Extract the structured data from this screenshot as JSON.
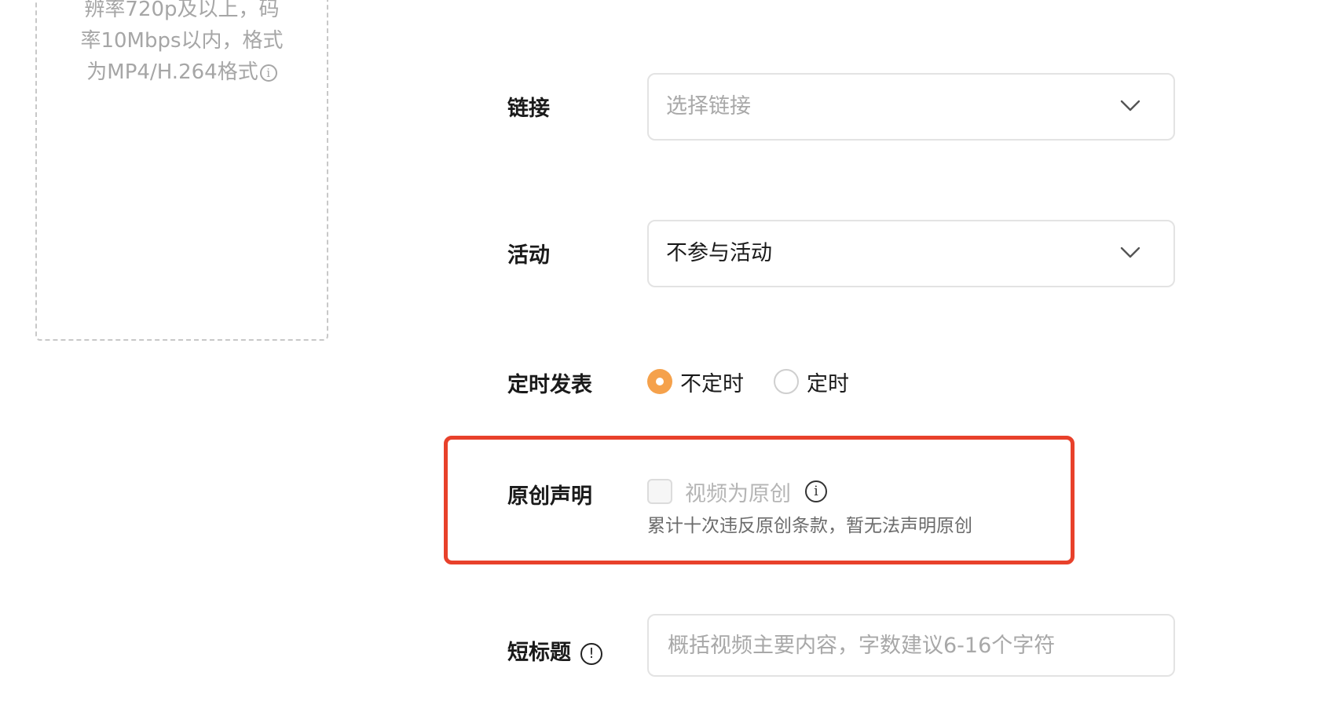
{
  "upload": {
    "hint_lines": [
      "辨率720p及以上，码",
      "率10Mbps以内，格式",
      "为MP4/H.264格式"
    ],
    "info_icon": "info-circle-icon"
  },
  "form": {
    "link": {
      "label": "链接",
      "placeholder": "选择链接",
      "chevron_icon": "chevron-down-icon"
    },
    "activity": {
      "label": "活动",
      "value": "不参与活动",
      "chevron_icon": "chevron-down-icon"
    },
    "schedule": {
      "label": "定时发表",
      "options": [
        {
          "label": "不定时",
          "checked": true
        },
        {
          "label": "定时",
          "checked": false
        }
      ],
      "accent_color": "#f5a14b"
    },
    "original": {
      "label": "原创声明",
      "checkbox_label": "视频为原创",
      "checked": false,
      "disabled": true,
      "info_icon": "info-circle-icon",
      "warning": "累计十次违反原创条款，暂无法声明原创",
      "highlight_color": "#e8412b"
    },
    "short_title": {
      "label": "短标题",
      "info_icon": "exclamation-circle-icon",
      "placeholder": "概括视频主要内容，字数建议6-16个字符",
      "value": ""
    }
  }
}
